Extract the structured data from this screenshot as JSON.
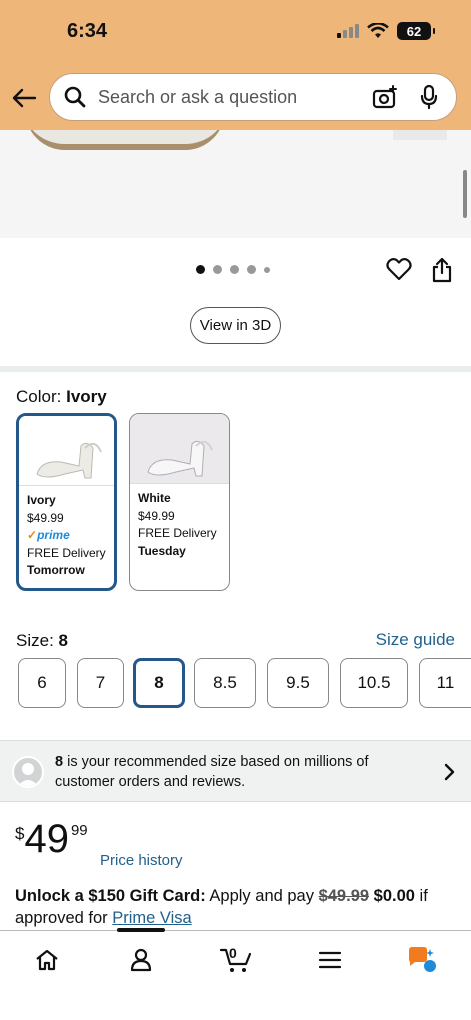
{
  "status_bar": {
    "time": "6:34",
    "battery": "62"
  },
  "search": {
    "placeholder": "Search or ask a question"
  },
  "gallery": {
    "view_3d_label": "View in 3D"
  },
  "color": {
    "label": "Color:",
    "selected": "Ivory",
    "options": [
      {
        "name": "Ivory",
        "price": "$49.99",
        "prime": "prime",
        "delivery": "FREE Delivery",
        "delivery_day": "Tomorrow"
      },
      {
        "name": "White",
        "price": "$49.99",
        "delivery": "FREE Delivery",
        "delivery_day": "Tuesday"
      }
    ]
  },
  "size": {
    "label": "Size:",
    "selected": "8",
    "guide_label": "Size guide",
    "options": [
      "6",
      "7",
      "8",
      "8.5",
      "9.5",
      "10.5",
      "11"
    ]
  },
  "recommendation": {
    "size": "8",
    "text": " is your recommended size based on millions of customer orders and reviews."
  },
  "price": {
    "currency": "$",
    "whole": "49",
    "fraction": "99",
    "history_label": "Price history"
  },
  "offer": {
    "headline": "Unlock a $150 Gift Card:",
    "text1": " Apply and pay ",
    "old_price": "$49.99",
    "new_price": "$0.00",
    "text2": " if approved for ",
    "link": "Prime Visa"
  },
  "bottom_nav": {
    "cart_count": "0"
  },
  "icons": [
    "back-arrow-icon",
    "search-icon",
    "camera-icon",
    "microphone-icon",
    "heart-icon",
    "share-icon",
    "user-icon",
    "chevron-right-icon",
    "home-icon",
    "cart-icon",
    "menu-icon",
    "rufus-icon"
  ],
  "colors": {
    "header_bg": "#efb679",
    "link": "#21618c",
    "selected_border": "#24588a",
    "prime_blue": "#1f8bd6"
  }
}
